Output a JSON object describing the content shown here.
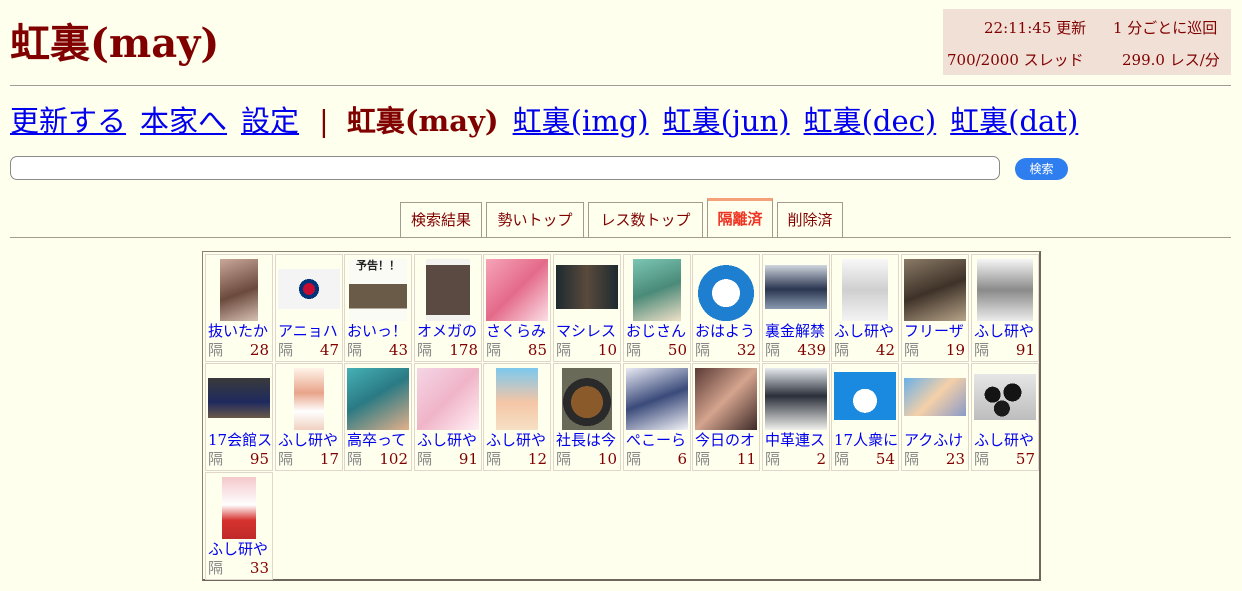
{
  "site": {
    "title": "虹裏(may)"
  },
  "status": {
    "time": "22:11:45 更新",
    "cycle": "1 分ごとに巡回",
    "threads": "700/2000 スレッド",
    "rate": "299.0 レス/分"
  },
  "nav": {
    "refresh": "更新する",
    "home": "本家へ",
    "settings": "設定",
    "separator": "|",
    "current": "虹裏(may)",
    "links": [
      "虹裏(img)",
      "虹裏(jun)",
      "虹裏(dec)",
      "虹裏(dat)"
    ]
  },
  "search": {
    "value": "",
    "placeholder": "",
    "button_label": "検索"
  },
  "tabs": {
    "active": "隔離済",
    "labels": [
      "検索結果",
      "勢いトップ",
      "レス数トップ",
      "隔離済",
      "削除済"
    ]
  },
  "catalog": {
    "flag_label": "隔",
    "items": [
      {
        "title": "抜いたか",
        "count": "28",
        "thumb": "anime-girl-image"
      },
      {
        "title": "アニョハ",
        "count": "47",
        "thumb": "korean-flag-image"
      },
      {
        "title": "おいっ！",
        "count": "43",
        "thumb": "yokoku-text-image",
        "thumb_text": "予告！！"
      },
      {
        "title": "オメガの",
        "count": "178",
        "thumb": "figure-image"
      },
      {
        "title": "さくらみ",
        "count": "85",
        "thumb": "pink-hair-girl-image"
      },
      {
        "title": "マシレス",
        "count": "10",
        "thumb": "man-portrait-image"
      },
      {
        "title": "おじさん",
        "count": "50",
        "thumb": "green-hair-girl-image"
      },
      {
        "title": "おはよう",
        "count": "32",
        "thumb": "doraemon-image"
      },
      {
        "title": "裏金解禁",
        "count": "439",
        "thumb": "press-conference-image"
      },
      {
        "title": "ふし研や",
        "count": "42",
        "thumb": "manga-sketch-image"
      },
      {
        "title": "フリーザ",
        "count": "19",
        "thumb": "man-face-image"
      },
      {
        "title": "ふし研や",
        "count": "91",
        "thumb": "manga-character-image"
      },
      {
        "title": "17会館ス",
        "count": "95",
        "thumb": "hall-image"
      },
      {
        "title": "ふし研や",
        "count": "17",
        "thumb": "chibi-girl-image"
      },
      {
        "title": "高卒って",
        "count": "102",
        "thumb": "teal-hair-girl-image"
      },
      {
        "title": "ふし研や",
        "count": "91",
        "thumb": "pastel-girls-image"
      },
      {
        "title": "ふし研や",
        "count": "12",
        "thumb": "beach-girl-image"
      },
      {
        "title": "社長は今",
        "count": "10",
        "thumb": "food-pan-image"
      },
      {
        "title": "ぺこーら",
        "count": "6",
        "thumb": "bunny-girl-image"
      },
      {
        "title": "今日のオ",
        "count": "11",
        "thumb": "two-girls-image"
      },
      {
        "title": "中革連ス",
        "count": "2",
        "thumb": "candidate-image"
      },
      {
        "title": "17人衆に",
        "count": "54",
        "thumb": "doraemon-blue-image"
      },
      {
        "title": "アクふけ",
        "count": "23",
        "thumb": "blue-hair-girl-image"
      },
      {
        "title": "ふし研や",
        "count": "57",
        "thumb": "black-balls-image"
      },
      {
        "title": "ふし研や",
        "count": "33",
        "thumb": "shrine-maiden-image"
      }
    ]
  }
}
